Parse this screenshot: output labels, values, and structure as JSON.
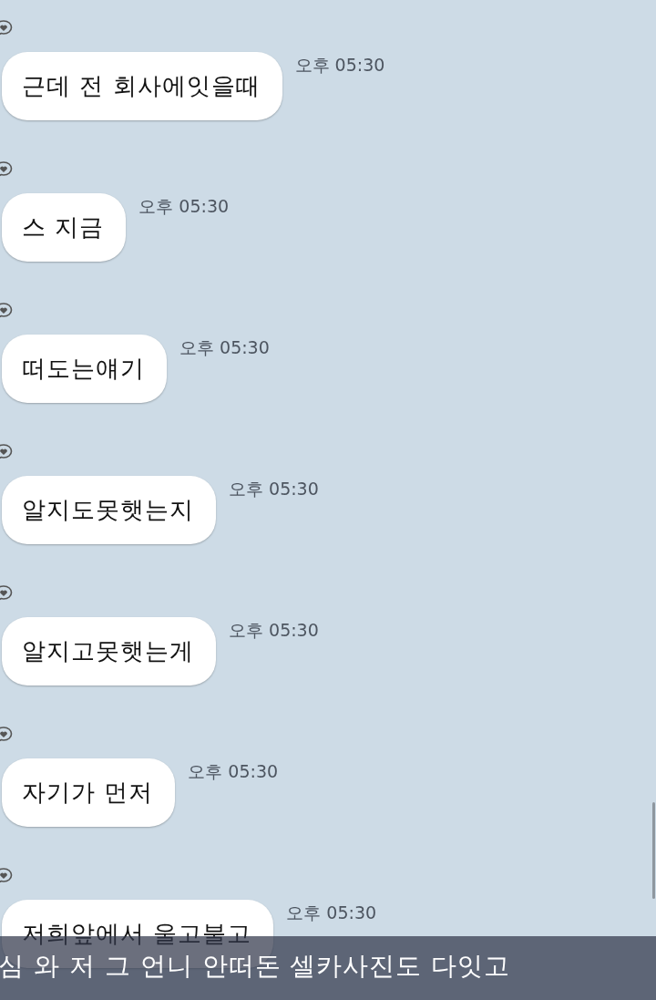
{
  "messages": [
    {
      "text": "근데 전 회사에잇을때",
      "time": "오후 05:30"
    },
    {
      "text": "스 지금",
      "time": "오후 05:30"
    },
    {
      "text": "떠도는얘기",
      "time": "오후 05:30"
    },
    {
      "text": "알지도못햇는지",
      "time": "오후 05:30"
    },
    {
      "text": "알지고못햇는게",
      "time": "오후 05:30"
    },
    {
      "text": "자기가 먼저",
      "time": "오후 05:30"
    },
    {
      "text": "저희앞에서 울고불고",
      "time": "오후 05:30"
    }
  ],
  "notification": {
    "text": "심 와 저 그 언니 안떠돈 셀카사진도 다잇고"
  }
}
